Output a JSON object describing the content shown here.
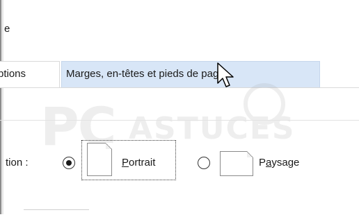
{
  "window": {
    "title_fragment": "e"
  },
  "tabs": [
    {
      "label": "ptions",
      "selected": false
    },
    {
      "label": "Marges, en-têtes et pieds de page",
      "selected": true
    }
  ],
  "orientation": {
    "label": "tion :",
    "options": [
      {
        "label_prefix": "",
        "label_mnemonic": "P",
        "label_rest": "ortrait",
        "checked": true,
        "icon": "portrait-page-icon"
      },
      {
        "label_prefix": "P",
        "label_mnemonic": "a",
        "label_rest": "ysage",
        "checked": false,
        "icon": "landscape-page-icon"
      }
    ]
  },
  "watermark": {
    "left": "PC",
    "right": "ASTUCES"
  },
  "colors": {
    "selected_tab_bg": "#d8e6f7",
    "border": "#d9d9d9"
  }
}
